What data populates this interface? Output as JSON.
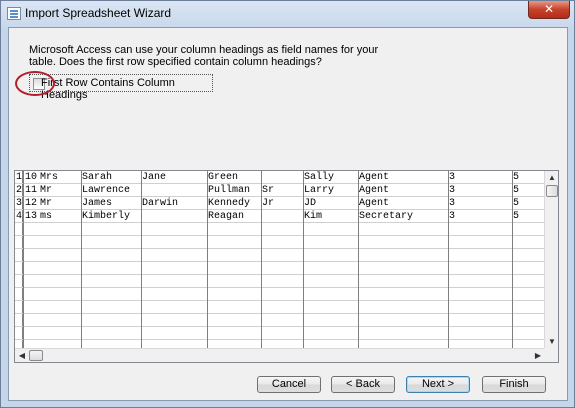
{
  "window": {
    "title": "Import Spreadsheet Wizard",
    "close_glyph": "✕"
  },
  "prompt": "Microsoft Access can use your column headings as field names for your table. Does the first row specified contain column headings?",
  "first_row_checkbox": {
    "label": "First Row Contains Column Headings",
    "checked": false
  },
  "rows": [
    [
      "1",
      "10",
      "Mrs",
      "Sarah",
      "Jane",
      "Green",
      "",
      "Sally",
      "Agent",
      "3",
      "5"
    ],
    [
      "2",
      "11",
      "Mr",
      "Lawrence",
      "",
      "Pullman",
      "Sr",
      "Larry",
      "Agent",
      "3",
      "5"
    ],
    [
      "3",
      "12",
      "Mr",
      "James",
      "Darwin",
      "Kennedy",
      "Jr",
      "JD",
      "Agent",
      "3",
      "5"
    ],
    [
      "4",
      "13",
      "ms",
      "Kimberly",
      "",
      "Reagan",
      "",
      "Kim",
      "Secretary",
      "3",
      "5"
    ]
  ],
  "scroll_arrows": {
    "up": "▲",
    "down": "▼",
    "left": "◀",
    "right": "▶"
  },
  "buttons": {
    "cancel": "Cancel",
    "back": "< Back",
    "next": "Next >",
    "finish": "Finish"
  }
}
